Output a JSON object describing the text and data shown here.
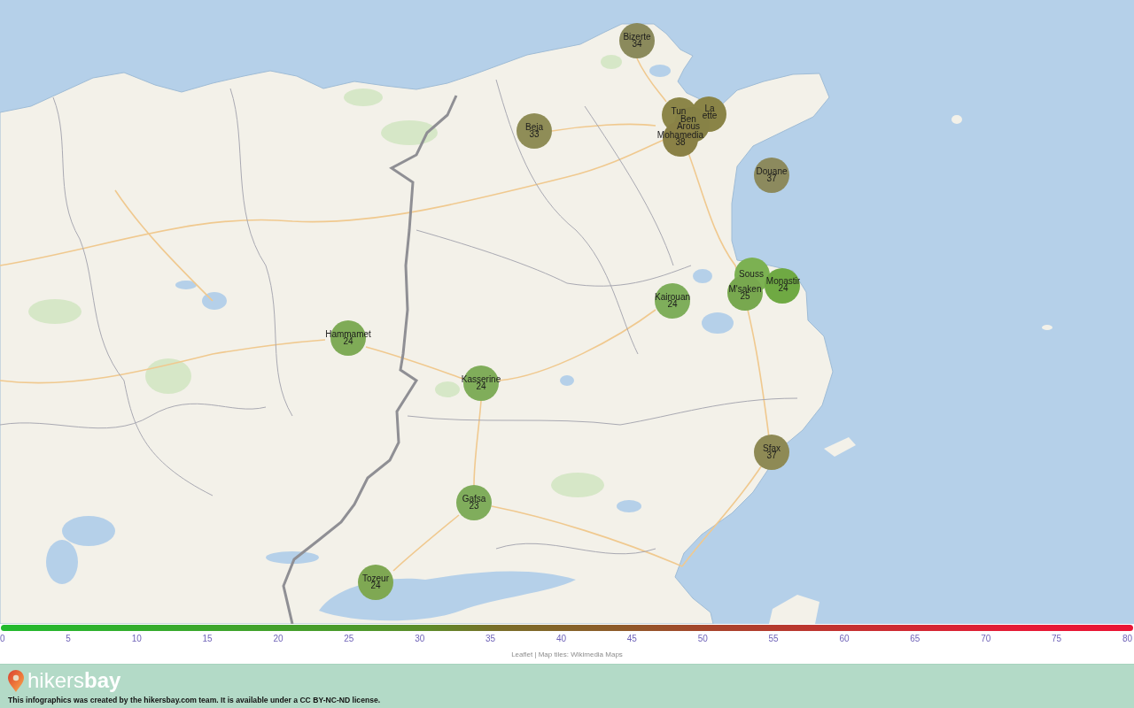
{
  "map": {
    "markers": [
      {
        "label_lines": [
          "Bizerte"
        ],
        "value": "34",
        "color": "#8b8a5c"
      },
      {
        "label_lines": [
          "Tun"
        ],
        "color": "#8c8649"
      },
      {
        "label_lines": [
          "La",
          "ette"
        ],
        "color": "#8a8447"
      },
      {
        "label_lines": [
          "Ben",
          "Arous"
        ],
        "color": "#878246"
      },
      {
        "label_lines": [
          "Beja"
        ],
        "value": "33",
        "color": "#8f8d57"
      },
      {
        "label_lines": [
          "Mohamedia"
        ],
        "value": "38",
        "color": "#8a8146"
      },
      {
        "label_lines": [
          "Douane"
        ],
        "value": "37",
        "color": "#8c8a5e"
      },
      {
        "label_lines": [
          "Souss"
        ],
        "color": "#7cb152"
      },
      {
        "label_lines": [
          "Monastir"
        ],
        "value": "24",
        "color": "#6fa943"
      },
      {
        "label_lines": [
          "M'saken"
        ],
        "value": "25",
        "color": "#78a84f"
      },
      {
        "label_lines": [
          "Kairouan"
        ],
        "value": "24",
        "color": "#7fae5b"
      },
      {
        "label_lines": [
          "Hammamet"
        ],
        "value": "24",
        "color": "#7fab57"
      },
      {
        "label_lines": [
          "Kasserine"
        ],
        "value": "24",
        "color": "#80ad5a"
      },
      {
        "label_lines": [
          "Sfax"
        ],
        "value": "37",
        "color": "#8e8a55"
      },
      {
        "label_lines": [
          "Gafsa"
        ],
        "value": "23",
        "color": "#80ad5c"
      },
      {
        "label_lines": [
          "Tozeur"
        ],
        "value": "24",
        "color": "#7fa853"
      }
    ]
  },
  "legend": {
    "ticks": [
      "0",
      "5",
      "10",
      "15",
      "20",
      "25",
      "30",
      "35",
      "40",
      "45",
      "50",
      "55",
      "60",
      "65",
      "70",
      "75",
      "80"
    ],
    "attribution": "Leaflet | Map tiles: Wikimedia Maps"
  },
  "footer": {
    "logo": "hikers**bay**",
    "credit": "This infographics was created by the hikersbay.com team. It is available under a CC BY-NC-ND license."
  }
}
